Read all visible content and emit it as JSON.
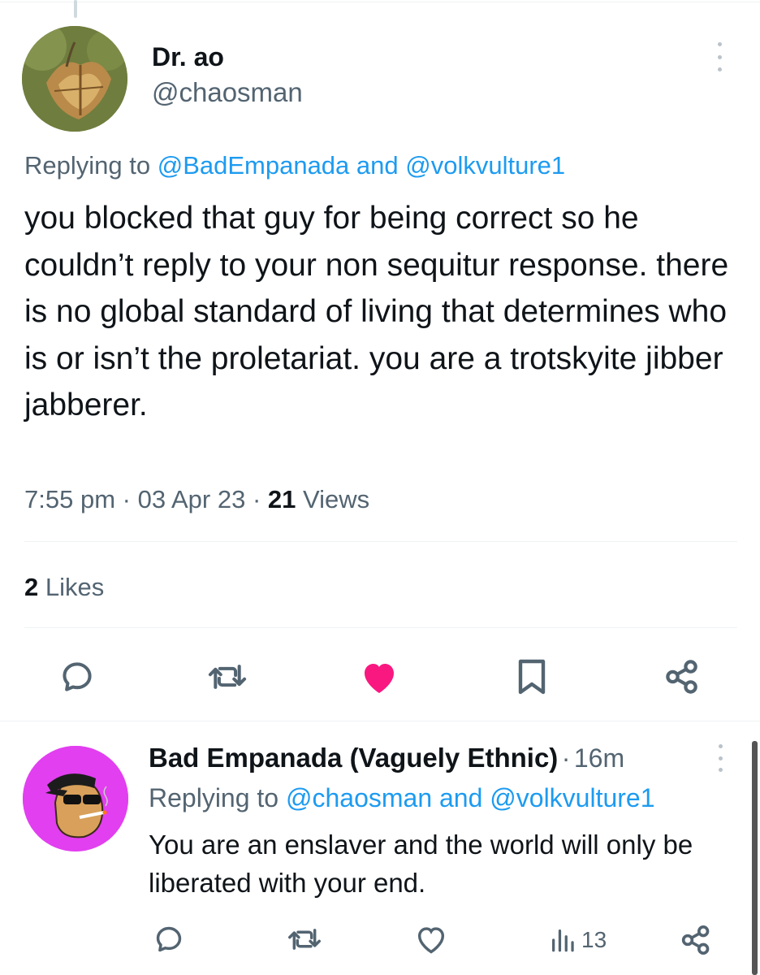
{
  "main_tweet": {
    "author_name": "Dr. ao",
    "author_handle": "@chaosman",
    "replying_prefix": "Replying to",
    "replying_handle_1": "@BadEmpanada",
    "replying_and": "and",
    "replying_handle_2": "@volkvulture1",
    "text": "you blocked that guy for being correct so he couldn’t reply to your non sequitur response. there is no global standard of living that determines who is or isn’t the proletariat. you are a trotskyite jibber jabberer.",
    "time": "7:55 pm",
    "date": "03 Apr 23",
    "views_count": "21",
    "views_label": "Views",
    "likes_count": "2",
    "likes_label": "Likes",
    "actions": [
      "reply-icon",
      "retweet-icon",
      "like-icon-filled",
      "bookmark-icon",
      "share-icon"
    ]
  },
  "reply_tweet": {
    "author_name": "Bad Empanada (Vaguely Ethnic)",
    "separator": "·",
    "time_ago": "16m",
    "replying_prefix": "Replying to",
    "replying_handle_1": "@chaosman",
    "replying_and": "and",
    "replying_handle_2": "@volkvulture1",
    "text": "You are an enslaver and the world will only be liberated with your end.",
    "views_count": "13",
    "actions": [
      "reply-icon",
      "retweet-icon",
      "like-icon",
      "views-icon",
      "share-icon"
    ]
  },
  "colors": {
    "link": "#1d9bf0",
    "secondary_text": "#536471",
    "like_pink": "#f91880",
    "icon_gray": "#536471",
    "reply_avatar_bg": "#e23ff0"
  }
}
